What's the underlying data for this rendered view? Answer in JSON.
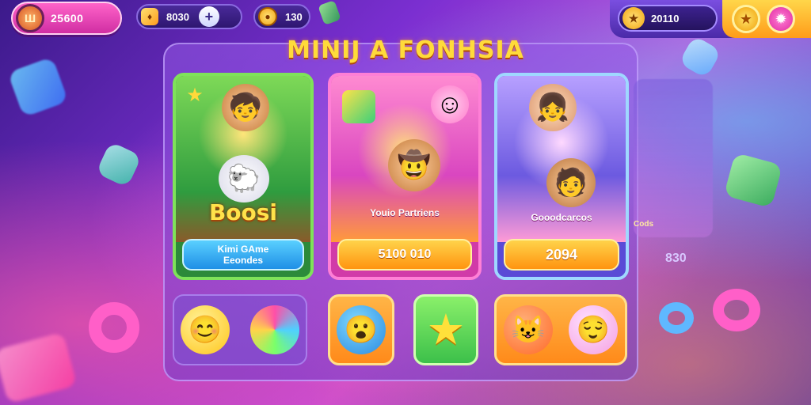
{
  "hud": {
    "player_badge": "Ш",
    "player_score": "25600",
    "gems": "8030",
    "plus": "+",
    "coins": "130",
    "trophies": "20110"
  },
  "title": "MINIJ A FONHSIA",
  "cards": [
    {
      "name": "boost",
      "art_label": "Boosi",
      "button_line1": "Kimi GAme",
      "button_line2": "Eeondes"
    },
    {
      "name": "party",
      "art_label": "Youio Partriens",
      "button_label": "5100 010"
    },
    {
      "name": "friends",
      "art_label": "Gooodcarcos",
      "button_label": "2094"
    }
  ],
  "side_card": {
    "caption": "Cods",
    "number": "830"
  },
  "icons": {
    "gem": "gem-icon",
    "coin": "coin-icon",
    "trophy": "trophy-icon",
    "star": "star-icon",
    "settings": "settings-icon"
  },
  "colors": {
    "accent_pink": "#ff63c9",
    "accent_yellow": "#ffdb3a",
    "panel_purple": "#7b2fd1"
  }
}
